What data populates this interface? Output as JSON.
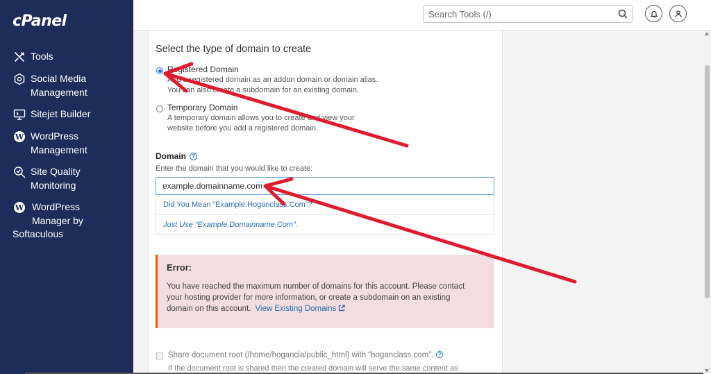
{
  "sidebar": {
    "logo": "cPanel",
    "items": [
      {
        "label": "Tools",
        "label2": ""
      },
      {
        "label": "Social Media",
        "label2": "Management"
      },
      {
        "label": "Sitejet Builder",
        "label2": ""
      },
      {
        "label": "WordPress",
        "label2": "Management"
      },
      {
        "label": "Site Quality",
        "label2": "Monitoring"
      },
      {
        "label": "WordPress",
        "label2": "Manager by",
        "label3": "Softaculous"
      }
    ]
  },
  "header": {
    "search_placeholder": "Search Tools (/)"
  },
  "form": {
    "title": "Select the type of domain to create",
    "options": [
      {
        "label": "Registered Domain",
        "desc1": "Add a registered domain as an addon domain or domain alias.",
        "desc2": "You can also create a subdomain for an existing domain.",
        "checked": true
      },
      {
        "label": "Temporary Domain",
        "desc1": "A temporary domain allows you to create and view your",
        "desc2": "website before you add a registered domain.",
        "checked": false
      }
    ],
    "domain_label": "Domain",
    "domain_hint": "Enter the domain that you would like to create:",
    "domain_value": "example.domainname.com",
    "suggestion_1": "Did You Mean “Example.Hoganclass.Com”?",
    "suggestion_2": "Just Use “Example.Domainname.Com”.",
    "error_title": "Error:",
    "error_line1": "You have reached the maximum number of domains for this account. Please contact",
    "error_line2": "your hosting provider for more information, or create a subdomain on an existing",
    "error_line3": "domain on this account.",
    "error_link": "View Existing Domains",
    "share_label": "Share document root (/home/hoganclа/public_html) with “hoganclass.com”.",
    "share_desc": "If the document root is shared then the created domain will serve the same content as"
  },
  "colors": {
    "sidebar_bg": "#1e2c5a",
    "accent": "#1a6fe8",
    "link": "#2a6db0",
    "error_bg": "#f2dede",
    "error_border": "#e8561a",
    "annotation": "#e01b2e"
  }
}
